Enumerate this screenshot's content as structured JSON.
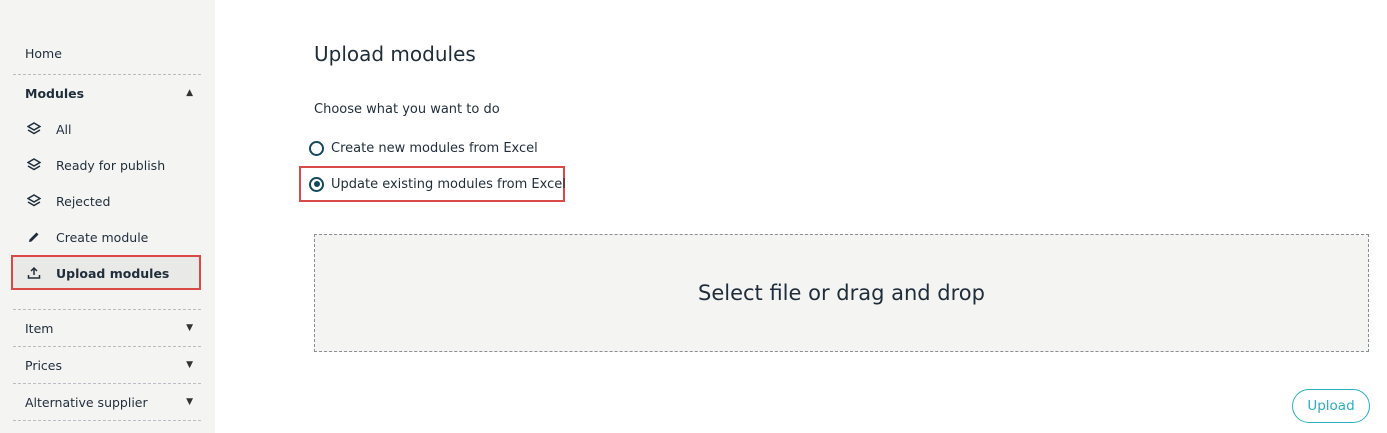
{
  "sidebar": {
    "home": "Home",
    "modules": {
      "label": "Modules",
      "items": [
        {
          "label": "All",
          "icon": "layers-icon"
        },
        {
          "label": "Ready for publish",
          "icon": "layers-icon"
        },
        {
          "label": "Rejected",
          "icon": "layers-icon"
        },
        {
          "label": "Create module",
          "icon": "pencil-icon"
        },
        {
          "label": "Upload modules",
          "icon": "upload-icon"
        }
      ]
    },
    "sections": [
      {
        "label": "Item"
      },
      {
        "label": "Prices"
      },
      {
        "label": "Alternative supplier"
      }
    ]
  },
  "main": {
    "title": "Upload modules",
    "choose_label": "Choose what you want to do",
    "options": [
      {
        "label": "Create new modules from Excel",
        "checked": false
      },
      {
        "label": "Update existing modules from Excel",
        "checked": true
      }
    ],
    "dropzone_text": "Select file or drag and drop",
    "upload_button": "Upload"
  },
  "colors": {
    "accent": "#2ab0c0",
    "highlight": "#d94a47",
    "radio": "#14485e",
    "sidebar_bg": "#f4f4f3"
  }
}
